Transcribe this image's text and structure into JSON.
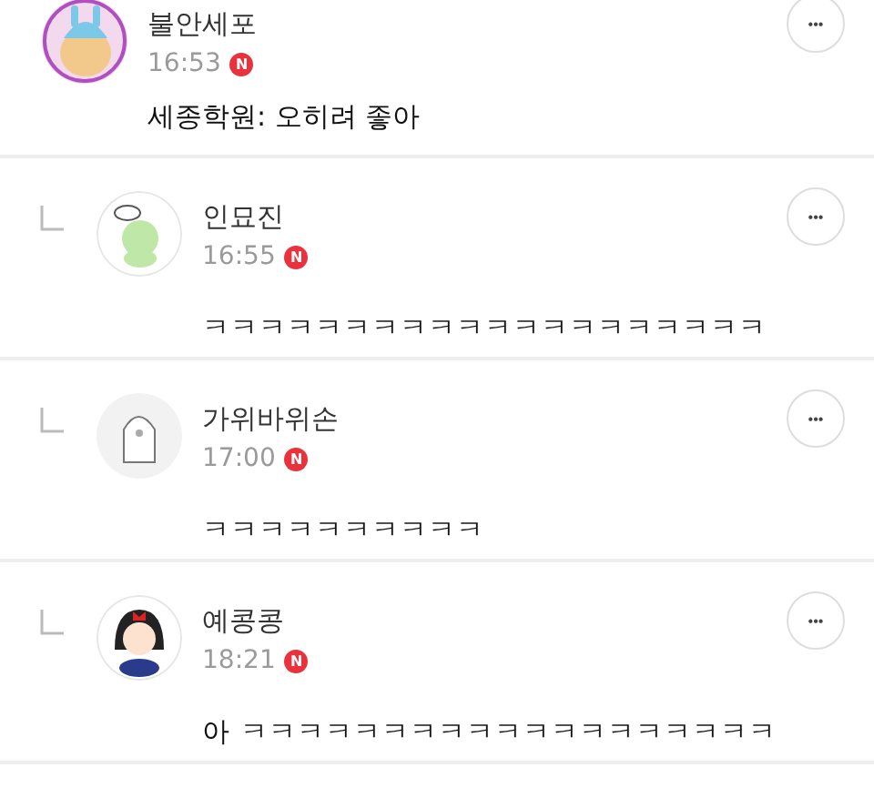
{
  "comments": [
    {
      "kind": "comment",
      "author": "불안세포",
      "time": "16:53",
      "new_badge": "N",
      "text": "세종학원: 오히려 좋아",
      "more": "•••"
    },
    {
      "kind": "reply",
      "author": "인묘진",
      "time": "16:55",
      "new_badge": "N",
      "text": "ㅋㅋㅋㅋㅋㅋㅋㅋㅋㅋㅋㅋㅋㅋㅋㅋㅋㅋㅋㅋ",
      "more": "•••"
    },
    {
      "kind": "reply",
      "author": "가위바위손",
      "time": "17:00",
      "new_badge": "N",
      "text": "ㅋㅋㅋㅋㅋㅋㅋㅋㅋㅋ",
      "more": "•••"
    },
    {
      "kind": "reply",
      "author": "예콩콩",
      "time": "18:21",
      "new_badge": "N",
      "text": "아 ㅋㅋㅋㅋㅋㅋㅋㅋㅋㅋㅋㅋㅋㅋㅋㅋㅋㅋㅋ",
      "more": "•••"
    }
  ]
}
